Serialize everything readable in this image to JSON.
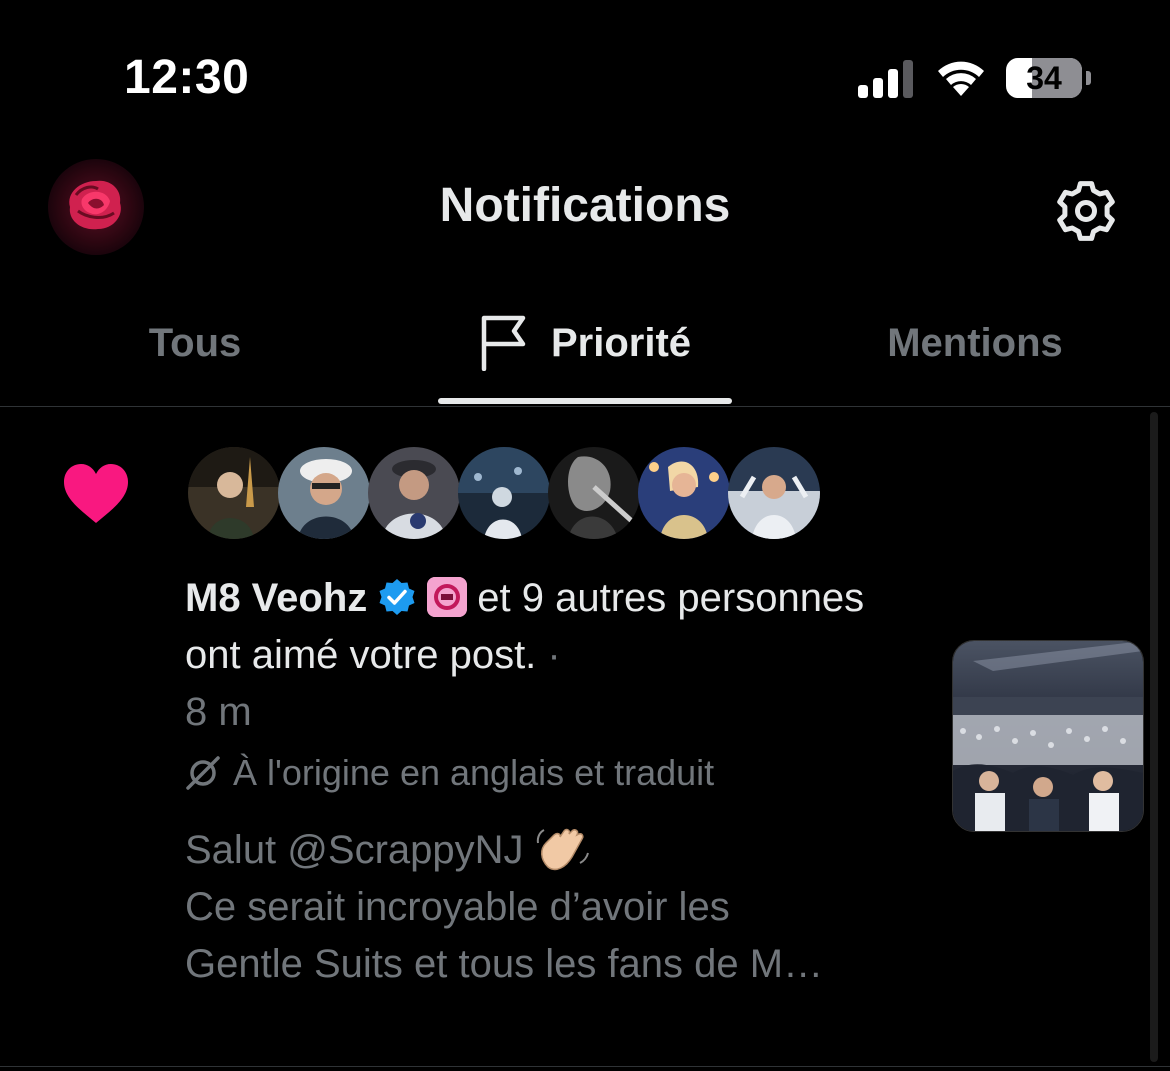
{
  "status_bar": {
    "time": "12:30",
    "battery_level": "34",
    "battery_fraction": 0.34,
    "signal_icon": "cellular-signal-icon",
    "wifi_icon": "wifi-icon"
  },
  "header": {
    "title": "Notifications",
    "avatar_icon": "rose-avatar",
    "settings_icon": "gear-icon"
  },
  "tabs": [
    {
      "label": "Tous",
      "active": false
    },
    {
      "label": "Priorité",
      "active": true,
      "icon": "flag-icon"
    },
    {
      "label": "Mentions",
      "active": false
    }
  ],
  "notification": {
    "icon": "heart-icon",
    "avatar_count": 7,
    "user_name": "M8 Veohz",
    "others_text": "et 9 autres personnes ont aimé votre post.",
    "separator": " · ",
    "time": "8 m",
    "translation_note": "À l'origine en anglais et traduit",
    "post_line1": "Salut @ScrappyNJ",
    "post_rest": "Ce serait incroyable d’avoir les\nGentle Suits et tous les fans de M…"
  },
  "colors": {
    "background": "#000000",
    "heart": "#f91880",
    "verified": "#1d9bf0",
    "muted_text": "#71767b",
    "primary_text": "#e7e9ea"
  }
}
